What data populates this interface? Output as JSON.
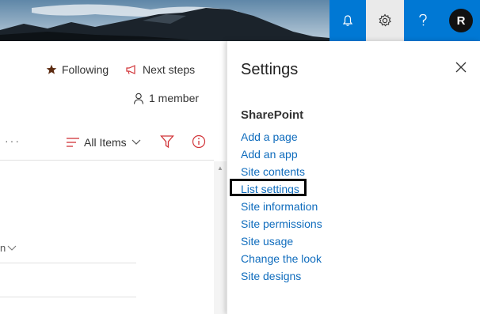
{
  "header": {
    "avatar_initial": "R"
  },
  "commandbar": {
    "following_label": "Following",
    "next_steps_label": "Next steps",
    "members_label": "1 member",
    "more_label": "···",
    "view_label": "All Items"
  },
  "list": {
    "column_fragment": "n"
  },
  "settings": {
    "title": "Settings",
    "section_title": "SharePoint",
    "links": [
      "Add a page",
      "Add an app",
      "Site contents",
      "List settings",
      "Site information",
      "Site permissions",
      "Site usage",
      "Change the look",
      "Site designs"
    ],
    "highlighted_index": 3
  },
  "icons": {
    "bell": "bell-icon",
    "gear": "gear-icon",
    "help": "question-icon",
    "star": "star-icon",
    "megaphone": "megaphone-icon",
    "person": "person-icon",
    "filter": "filter-icon",
    "info": "info-icon",
    "close": "close-icon",
    "chevron": "chevron-down-icon"
  },
  "colors": {
    "suite_blue": "#0078d4",
    "link_blue": "#0f6cbd",
    "star_brown": "#5c2b11",
    "accent_red": "#d13438"
  }
}
